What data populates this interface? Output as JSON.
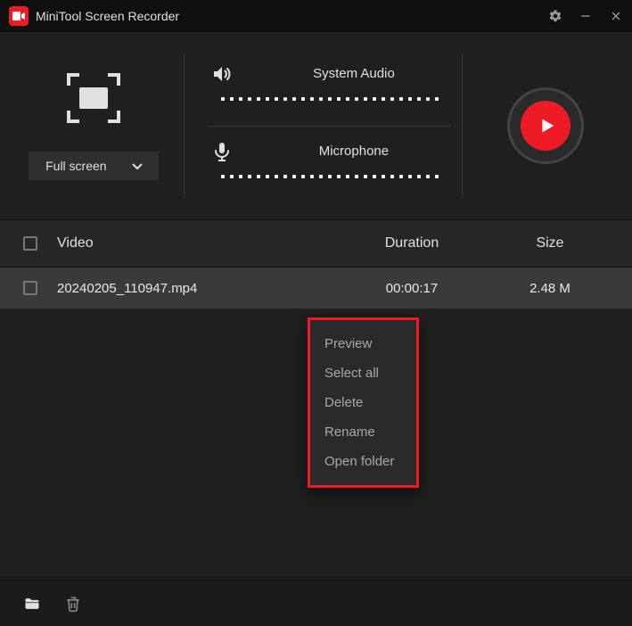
{
  "app": {
    "title": "MiniTool Screen Recorder"
  },
  "controls": {
    "mode_label": "Full screen",
    "system_audio_label": "System Audio",
    "mic_label": "Microphone"
  },
  "table": {
    "headers": {
      "video": "Video",
      "duration": "Duration",
      "size": "Size"
    },
    "rows": [
      {
        "filename": "20240205_110947.mp4",
        "duration": "00:00:17",
        "size": "2.48 M"
      }
    ]
  },
  "context_menu": {
    "items": [
      "Preview",
      "Select all",
      "Delete",
      "Rename",
      "Open folder"
    ]
  }
}
